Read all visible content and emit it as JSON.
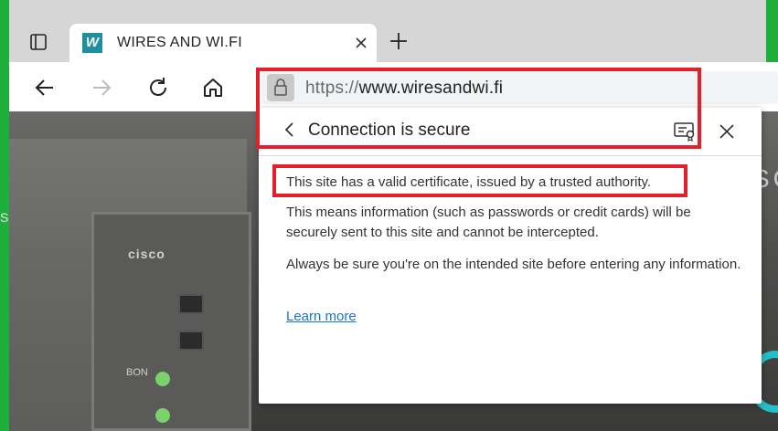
{
  "tab": {
    "logo_letter": "W",
    "title": "WIRES AND WI.FI"
  },
  "address": {
    "scheme": "https://",
    "host": "www.wiresandwi.fi"
  },
  "popup": {
    "title": "Connection is secure",
    "line1": "This site has a valid certificate, issued by a trusted authority.",
    "line2": "This means information (such as passwords or credit cards) will be securely sent to this site and cannot be intercepted.",
    "line3": "Always be sure you're on the intended site before entering any information.",
    "learn_more": "Learn more"
  },
  "background_page": {
    "brand": "cisco",
    "right_fragment": "SC",
    "bon_label": "BON",
    "left_char": "S"
  },
  "colors": {
    "highlight": "#e3202a",
    "link": "#1a73c8",
    "desktop": "#1fae3c"
  }
}
